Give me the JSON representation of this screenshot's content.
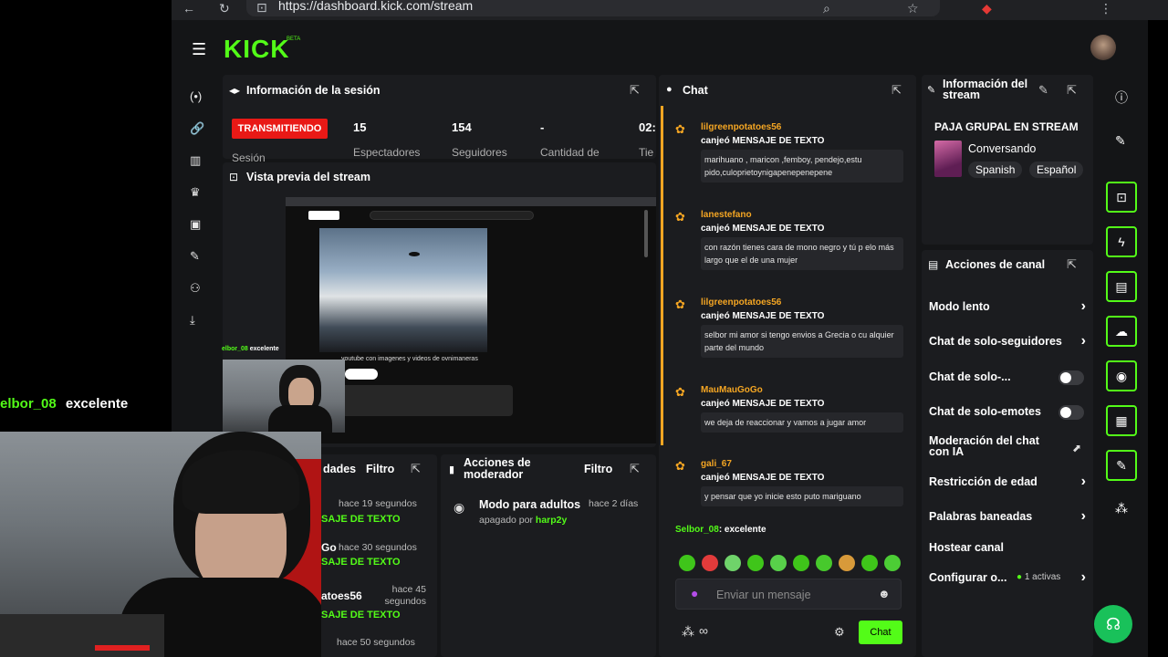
{
  "browser": {
    "url": "https://dashboard.kick.com/stream"
  },
  "app": {
    "logo": "KICK",
    "logo_badge": "BETA"
  },
  "left_nav": [
    "broadcast-icon",
    "link-icon",
    "analytics-icon",
    "trophy-icon",
    "video-icon",
    "wrench-icon",
    "users-icon",
    "download-icon"
  ],
  "session": {
    "title": "Información de la sesión",
    "status": "TRANSMITIENDO",
    "status_sub": "Sesión",
    "stats": [
      {
        "value": "15",
        "label": "Espectadores"
      },
      {
        "value": "154",
        "label": "Seguidores"
      },
      {
        "value": "-",
        "label": "Cantidad de"
      },
      {
        "value": "02:",
        "label": "Tie"
      }
    ]
  },
  "preview": {
    "title": "Vista previa del stream",
    "yt_title": "youtube con imagenes y videos de ovnimaneras"
  },
  "overlay_chat": {
    "user": "elbor_08",
    "message": "excelente"
  },
  "overlay_small": {
    "user": "elbor_08",
    "message": "excelente"
  },
  "activity": {
    "title": "dades",
    "filter": "Filtro",
    "items": [
      {
        "time": "hace 19 segundos",
        "text": "SAJE DE TEXTO"
      },
      {
        "name": "Go",
        "time": "hace 30 segundos",
        "text": "SAJE DE TEXTO"
      },
      {
        "name": "atoes56",
        "time": "hace 45 segundos",
        "text": "SAJE DE TEXTO"
      },
      {
        "time": "hace 50 segundos"
      }
    ]
  },
  "mod_actions": {
    "title": "Acciones de moderador",
    "filter": "Filtro",
    "item": {
      "title": "Modo para adultos",
      "time": "hace 2 días",
      "by_label": "apagado por",
      "by_user": "harp2y"
    }
  },
  "chat": {
    "title": "Chat",
    "messages": [
      {
        "user": "lilgreenpotatoes56",
        "action": "canjeó MENSAJE DE TEXTO",
        "body": "marihuano , maricon ,femboy, pendejo,estu pido,culoprietoynigapenepenepene"
      },
      {
        "user": "lanestefano",
        "action": "canjeó MENSAJE DE TEXTO",
        "body": "con razón tienes cara de mono negro y tú p elo más largo que el de una mujer"
      },
      {
        "user": "lilgreenpotatoes56",
        "action": "canjeó MENSAJE DE TEXTO",
        "body": "selbor mi amor si tengo envios a Grecia o cu alquier parte del mundo"
      },
      {
        "user": "MauMauGoGo",
        "action": "canjeó MENSAJE DE TEXTO",
        "body": "we deja de reaccionar y vamos a jugar amor"
      },
      {
        "user": "gali_67",
        "action": "canjeó MENSAJE DE TEXTO",
        "body": "y pensar que yo inicie esto puto mariguano"
      }
    ],
    "last": {
      "user": "Selbor_08",
      "message": ": excelente"
    },
    "placeholder": "Enviar un mensaje",
    "send_label": "Chat"
  },
  "stream_info": {
    "title": "Información del stream",
    "stream_title": "PAJA GRUPAL EN STREAM",
    "category": "Conversando",
    "tags": [
      "Spanish",
      "Español"
    ]
  },
  "channel_actions": {
    "title": "Acciones de canal",
    "items": [
      {
        "label": "Modo lento",
        "control": "chevron"
      },
      {
        "label": "Chat de solo-seguidores",
        "control": "chevron"
      },
      {
        "label": "Chat de solo-...",
        "control": "toggle"
      },
      {
        "label": "Chat de solo-emotes",
        "control": "toggle"
      },
      {
        "label": "Moderación del chat con IA",
        "control": "external"
      },
      {
        "label": "Restricción de edad",
        "control": "chevron"
      },
      {
        "label": "Palabras baneadas",
        "control": "chevron"
      },
      {
        "label": "Hostear canal",
        "control": "none"
      },
      {
        "label": "Configurar o...",
        "control": "chevron",
        "badge": "1 activas"
      }
    ]
  },
  "colors": {
    "brand": "#53fc18",
    "live": "#e91916",
    "accent": "#f5a623",
    "panel": "#1b1c1f"
  }
}
